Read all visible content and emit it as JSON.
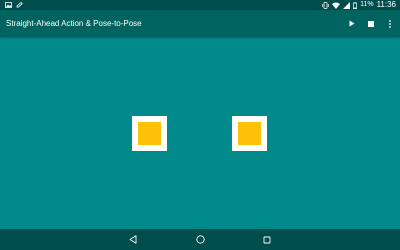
{
  "status_bar": {
    "left_icons": [
      "image-icon",
      "edit-icon"
    ],
    "right_icons": [
      "vibrate-icon",
      "wifi-icon",
      "signal-icon",
      "battery-icon"
    ],
    "battery_text": "11%",
    "time": "11:36"
  },
  "app_bar": {
    "title": "Straight-Ahead Action & Pose-to-Pose",
    "actions": [
      "play-icon",
      "stop-icon",
      "overflow-menu-icon"
    ]
  },
  "content": {
    "squares": [
      {
        "name": "animated-square-left",
        "color": "#ffc107"
      },
      {
        "name": "animated-square-right",
        "color": "#ffc107"
      }
    ]
  },
  "nav_bar": {
    "buttons": [
      "back-icon",
      "home-icon",
      "recents-icon"
    ]
  },
  "colors": {
    "background": "#00898a",
    "app_bar": "#00635f",
    "status_bar": "#004d4d",
    "accent": "#ffc107"
  }
}
